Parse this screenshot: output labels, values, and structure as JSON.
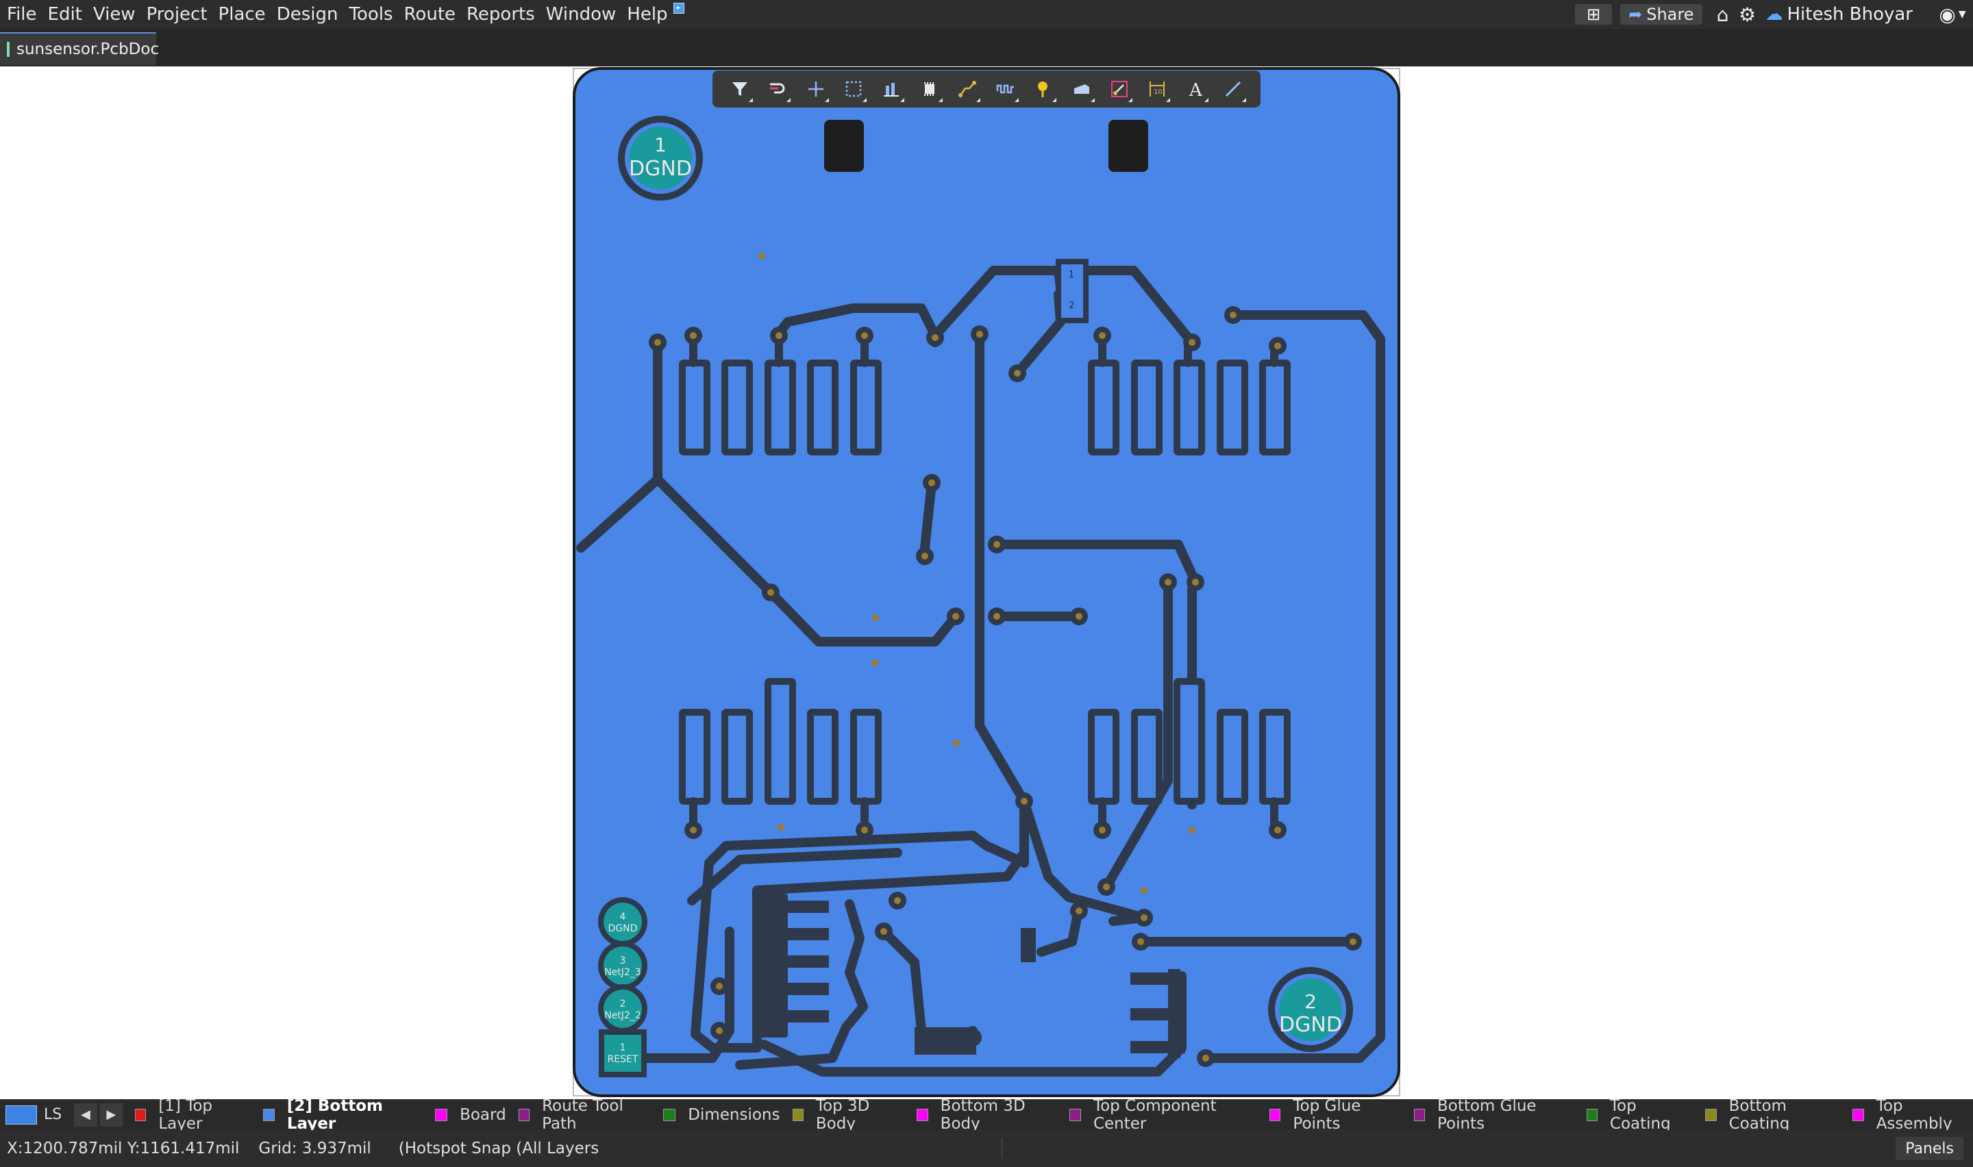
{
  "menu": {
    "items": [
      "File",
      "Edit",
      "View",
      "Project",
      "Place",
      "Design",
      "Tools",
      "Route",
      "Reports",
      "Window",
      "Help"
    ]
  },
  "topbar": {
    "share_label": "Share",
    "user_name": "Hitesh Bhoyar"
  },
  "document": {
    "tab_name": "sunsensor.PcbDoc"
  },
  "canvas_toolbar": {
    "tools": [
      "filter-icon",
      "interactive-route-icon",
      "place-cross-icon",
      "select-rect-icon",
      "align-icon",
      "component-icon",
      "route-multiple-icon",
      "tune-length-icon",
      "net-inspector-icon",
      "polygon-pour-icon",
      "via-fanout-icon",
      "dimension-icon",
      "text-string-icon",
      "line-icon"
    ]
  },
  "board": {
    "background_color": "#4a86e8",
    "trace_color": "#2e3a4c",
    "pad_color": "#5b5b5b",
    "via_color": "#9a7b2f",
    "mounting_holes": [
      {
        "number": "1",
        "net": "DGND"
      },
      {
        "number": "2",
        "net": "DGND"
      }
    ],
    "connector_pins": [
      {
        "number": "4",
        "net": "DGND"
      },
      {
        "number": "3",
        "net": "NetJ2_3"
      },
      {
        "number": "2",
        "net": "NetJ2_2"
      },
      {
        "number": "1",
        "net": "RESET"
      }
    ],
    "small_comp_labels": [
      "1",
      "2"
    ]
  },
  "layer_bar": {
    "set_label": "LS",
    "layers": [
      {
        "name": "[1] Top Layer",
        "color": "#e11b1b",
        "active": false
      },
      {
        "name": "[2] Bottom Layer",
        "color": "#4a86e8",
        "active": true
      },
      {
        "name": "Board",
        "color": "#ff00ff",
        "active": false
      },
      {
        "name": "Route Tool Path",
        "color": "#8a1d8a",
        "active": false
      },
      {
        "name": "Dimensions",
        "color": "#1d7d1d",
        "active": false
      },
      {
        "name": "Top 3D Body",
        "color": "#8a8a1d",
        "active": false
      },
      {
        "name": "Bottom 3D Body",
        "color": "#ff00ff",
        "active": false
      },
      {
        "name": "Top Component Center",
        "color": "#8a1d8a",
        "active": false
      },
      {
        "name": "Top Glue Points",
        "color": "#ff00ff",
        "active": false
      },
      {
        "name": "Bottom Glue Points",
        "color": "#8a1d8a",
        "active": false
      },
      {
        "name": "Top Coating",
        "color": "#1d7d1d",
        "active": false
      },
      {
        "name": "Bottom Coating",
        "color": "#8a8a1d",
        "active": false
      },
      {
        "name": "Top Assembly",
        "color": "#ff00ff",
        "active": false
      }
    ]
  },
  "status": {
    "coords": "X:1200.787mil Y:1161.417mil",
    "grid": "Grid: 3.937mil",
    "snap": "(Hotspot Snap (All Layers",
    "panels_label": "Panels"
  }
}
